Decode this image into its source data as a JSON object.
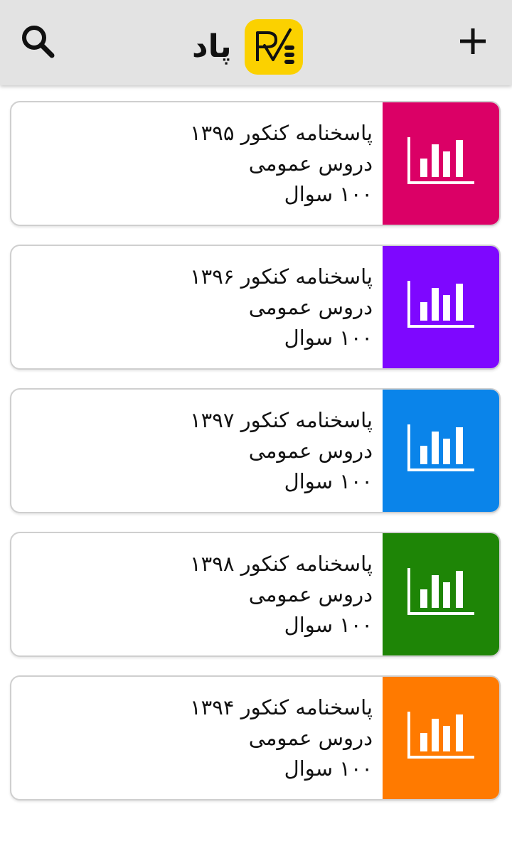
{
  "header": {
    "app_name": "پاد",
    "icons": {
      "search": "search-icon",
      "add": "plus-icon",
      "logo": "app-logo"
    }
  },
  "cards": [
    {
      "title": "پاسخنامه کنکور ۱۳۹۵",
      "subject": "دروس عمومی",
      "count": "۱۰۰ سوال",
      "color": "#db0066",
      "icon": "bar-chart-icon"
    },
    {
      "title": "پاسخنامه کنکور ۱۳۹۶",
      "subject": "دروس عمومی",
      "count": "۱۰۰ سوال",
      "color": "#7e07ff",
      "icon": "bar-chart-icon"
    },
    {
      "title": "پاسخنامه کنکور ۱۳۹۷",
      "subject": "دروس عمومی",
      "count": "۱۰۰ سوال",
      "color": "#0a84ea",
      "icon": "bar-chart-icon"
    },
    {
      "title": "پاسخنامه کنکور ۱۳۹۸",
      "subject": "دروس عمومی",
      "count": "۱۰۰ سوال",
      "color": "#1e8506",
      "icon": "bar-chart-icon"
    },
    {
      "title": "پاسخنامه کنکور ۱۳۹۴",
      "subject": "دروس عمومی",
      "count": "۱۰۰ سوال",
      "color": "#ff7a00",
      "icon": "bar-chart-icon"
    }
  ]
}
